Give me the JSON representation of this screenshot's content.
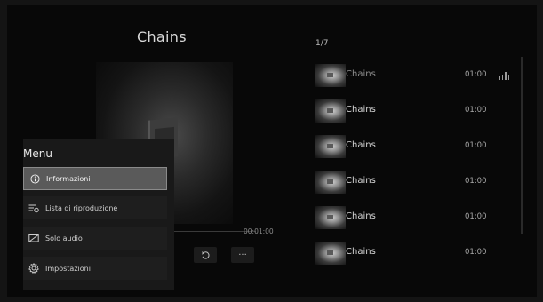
{
  "player": {
    "title": "Chains",
    "time_total": "00:01:00"
  },
  "controls": [
    {
      "name": "repeat-icon",
      "glyph": "↻"
    },
    {
      "name": "more-options-icon",
      "glyph": "···"
    }
  ],
  "menu": {
    "title": "Menu",
    "items": [
      {
        "label": "Informazioni",
        "icon": "info-icon"
      },
      {
        "label": "Lista di riproduzione",
        "icon": "playlist-icon"
      },
      {
        "label": "Solo audio",
        "icon": "audio-only-icon"
      },
      {
        "label": "Impostazioni",
        "icon": "settings-icon"
      }
    ],
    "selected_index": 0
  },
  "playlist": {
    "counter": "1/7",
    "tracks": [
      {
        "name": "Chains",
        "duration": "01:00",
        "now_playing": true
      },
      {
        "name": "Chains",
        "duration": "01:00"
      },
      {
        "name": "Chains",
        "duration": "01:00"
      },
      {
        "name": "Chains",
        "duration": "01:00"
      },
      {
        "name": "Chains",
        "duration": "01:00"
      },
      {
        "name": "Chains",
        "duration": "01:00"
      }
    ]
  },
  "colors": {
    "background": "#080808",
    "selected_item": "#5a5a5a",
    "text": "#d6d6d6"
  }
}
